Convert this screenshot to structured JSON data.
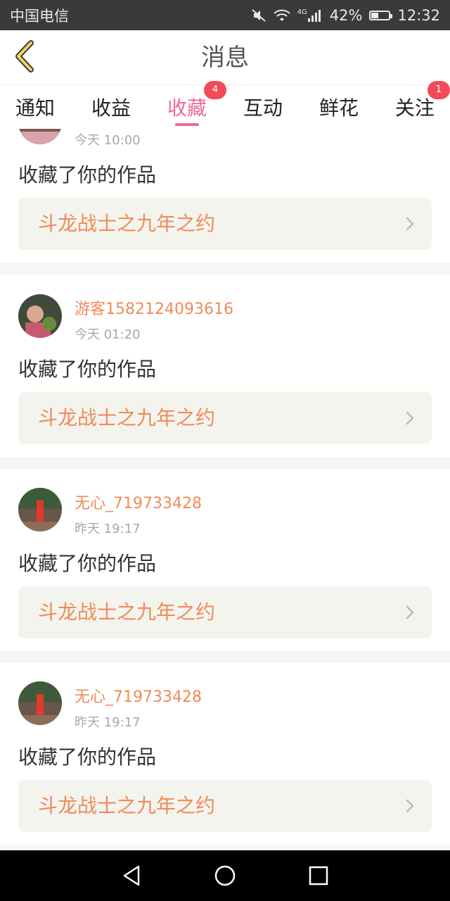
{
  "status_bar": {
    "carrier": "中国电信",
    "network_type": "4G",
    "battery_percent": "42%",
    "battery_level": 0.42,
    "time": "12:32",
    "icons": [
      "mute-icon",
      "wifi-icon",
      "signal-icon",
      "battery-icon"
    ]
  },
  "header": {
    "title": "消息",
    "back_icon": "chevron-left-icon"
  },
  "tabs": [
    {
      "label": "通知",
      "badge": null
    },
    {
      "label": "收益",
      "badge": null
    },
    {
      "label": "收藏",
      "badge": "4",
      "active": true
    },
    {
      "label": "互动",
      "badge": null
    },
    {
      "label": "鲜花",
      "badge": null
    },
    {
      "label": "关注",
      "badge": "1"
    }
  ],
  "colors": {
    "accent_pink": "#ec6b9a",
    "username_orange": "#ef8b59",
    "badge_red": "#f24a5a"
  },
  "messages": [
    {
      "username": "",
      "time": "今天 10:00",
      "action": "收藏了你的作品",
      "work_title": "斗龙战士之九年之约"
    },
    {
      "username": "游客1582124093616",
      "time": "今天 01:20",
      "action": "收藏了你的作品",
      "work_title": "斗龙战士之九年之约"
    },
    {
      "username": "无心_719733428",
      "time": "昨天 19:17",
      "action": "收藏了你的作品",
      "work_title": "斗龙战士之九年之约"
    },
    {
      "username": "无心_719733428",
      "time": "昨天 19:17",
      "action": "收藏了你的作品",
      "work_title": "斗龙战士之九年之约"
    }
  ],
  "nav_bar": {
    "icons": [
      "back-triangle-icon",
      "home-circle-icon",
      "recents-square-icon"
    ]
  }
}
